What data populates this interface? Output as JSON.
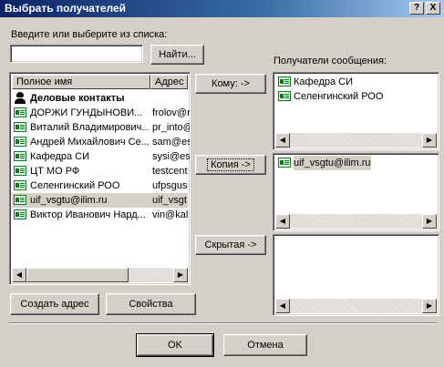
{
  "window": {
    "title": "Выбрать получателей",
    "help_glyph": "?",
    "close_glyph": "X"
  },
  "search": {
    "label": "Введите или выберите из списка:",
    "value": "",
    "find_button": "Найти..."
  },
  "contacts": {
    "columns": [
      "Полное имя",
      "Адрес э"
    ],
    "rows": [
      {
        "name": "Деловые контакты",
        "addr": "",
        "icon": "group-icon",
        "bold": true
      },
      {
        "name": "ДОРЖИ ГУНДЫНОВИ...",
        "addr": "frolov@r",
        "icon": "contact-card-icon"
      },
      {
        "name": "Виталий Владимирович...",
        "addr": "pr_into@",
        "icon": "contact-card-icon"
      },
      {
        "name": "Андрей Михайлович Се...",
        "addr": "sam@es",
        "icon": "contact-card-icon"
      },
      {
        "name": "Кафедра СИ",
        "addr": "sysi@es",
        "icon": "contact-card-icon"
      },
      {
        "name": "ЦТ МО РФ",
        "addr": "testcent",
        "icon": "contact-card-icon"
      },
      {
        "name": "Селенгинский РОО",
        "addr": "ufpsgus",
        "icon": "contact-card-icon"
      },
      {
        "name": "uif_vsgtu@ilim.ru",
        "addr": "uif_vsgt",
        "icon": "contact-card-icon",
        "selected": true
      },
      {
        "name": "Виктор Иванович Нард...",
        "addr": "vin@kal",
        "icon": "contact-card-icon"
      }
    ],
    "create_button": "Создать адрес",
    "properties_button": "Свойства"
  },
  "recipients": {
    "label": "Получатели сообщения:",
    "to_button": "Кому: ->",
    "cc_button": "Копия ->",
    "bcc_button": "Скрытая ->",
    "to": [
      "Кафедра СИ",
      "Селенгинский РОО"
    ],
    "cc": [
      "uif_vsgtu@ilim.ru"
    ],
    "bcc": []
  },
  "footer": {
    "ok": "OK",
    "cancel": "Отмена"
  },
  "colors": {
    "face": "#d4d0c8",
    "title_start": "#0a246a",
    "title_end": "#a6caf0",
    "contact_icon": "#0a7a20"
  }
}
